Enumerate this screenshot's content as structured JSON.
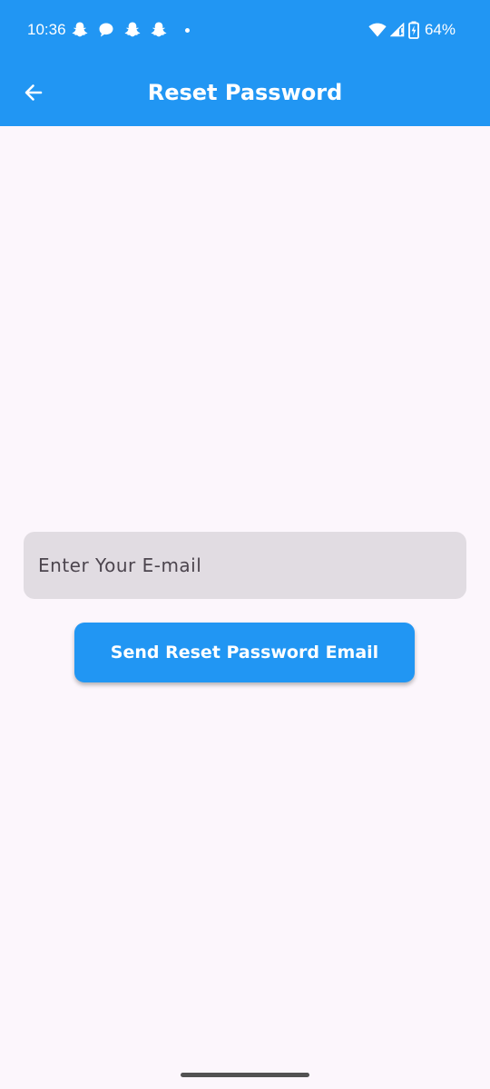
{
  "status_bar": {
    "time": "10:36",
    "battery_percent": "64%",
    "notification_icons": [
      "snapchat-icon",
      "chat-icon",
      "snapchat-icon",
      "snapchat-icon"
    ]
  },
  "app_bar": {
    "title": "Reset Password",
    "back_icon": "arrow-left-icon"
  },
  "form": {
    "email_placeholder": "Enter Your E-mail",
    "email_value": "",
    "submit_label": "Send Reset Password Email"
  },
  "colors": {
    "primary": "#2196f3",
    "background": "#fcf6fc",
    "field_fill": "#e1dce2",
    "on_primary": "#ffffff"
  }
}
